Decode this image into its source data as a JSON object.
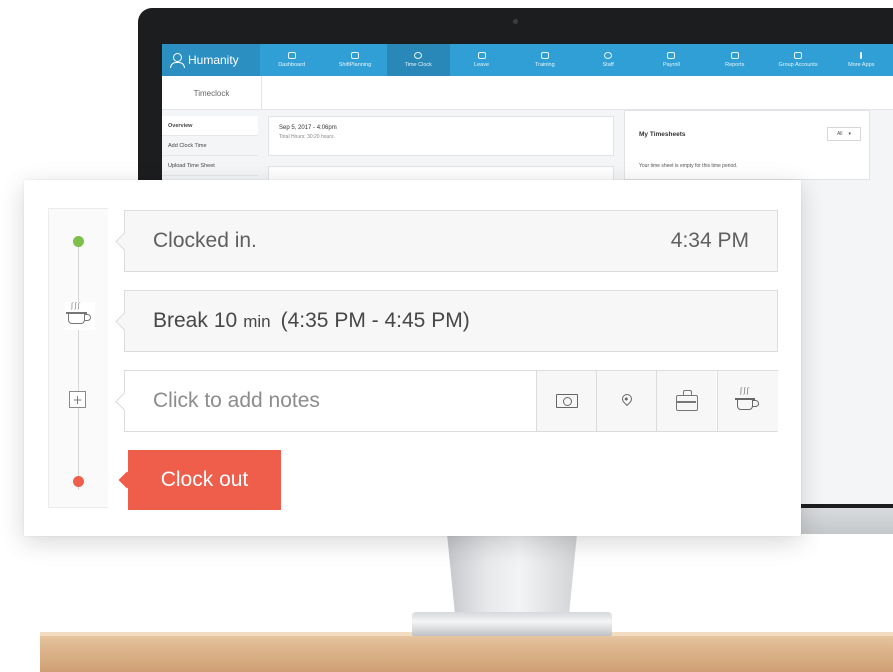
{
  "app": {
    "brand": "Humanity",
    "nav": [
      {
        "label": "Dashboard"
      },
      {
        "label": "ShiftPlanning"
      },
      {
        "label": "Time Clock",
        "active": true
      },
      {
        "label": "Leave"
      },
      {
        "label": "Training"
      },
      {
        "label": "Staff"
      },
      {
        "label": "Payroll"
      },
      {
        "label": "Reports"
      },
      {
        "label": "Group Accounts"
      },
      {
        "label": "More Apps"
      }
    ],
    "sub_tab": "Timeclock",
    "sidebar": [
      {
        "label": "Overview",
        "active": true
      },
      {
        "label": "Add Clock Time"
      },
      {
        "label": "Upload Time Sheet"
      }
    ],
    "clock_card": {
      "date": "Sep 5, 2017 - 4:06pm",
      "hours": "Total Hours: 30:20 hours."
    },
    "timesheets": {
      "title": "My Timesheets",
      "filter": "All",
      "empty": "Your time sheet is empty for this time period."
    }
  },
  "card": {
    "clocked_in": {
      "label": "Clocked in.",
      "time": "4:34 PM"
    },
    "break": {
      "word": "Break",
      "minutes": "10",
      "unit": "min",
      "range": "(4:35 PM - 4:45 PM)"
    },
    "notes": {
      "placeholder": "Click to add notes"
    },
    "clock_out": "Clock out"
  },
  "colors": {
    "accent_blue": "#2f9fd5",
    "clock_out_red": "#ee5e4b",
    "status_green": "#7cbf4a"
  }
}
